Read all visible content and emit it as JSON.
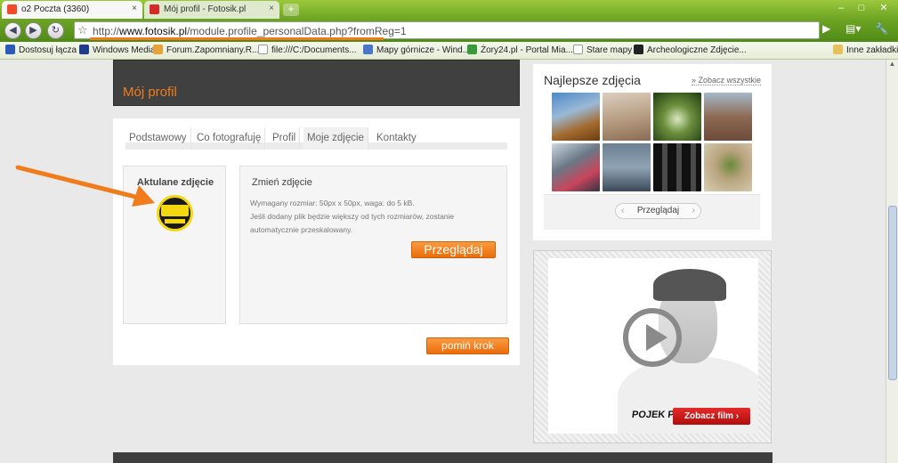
{
  "browser": {
    "tabs": [
      {
        "label": "o2 Poczta (3360)",
        "active": true
      },
      {
        "label": "Mój profil - Fotosik.pl",
        "active": false
      }
    ],
    "url_prefix": "http://",
    "url_domain": "www.fotosik.pl",
    "url_path": "/module.profile_personalData.php?fromReg=1",
    "bookmarks": [
      "Dostosuj łącza",
      "Windows Media",
      "Forum.Zapomniany.R...",
      "file:///C:/Documents...",
      "Mapy górnicze - Wind...",
      "Żory24.pl - Portal Mia...",
      "Stare mapy",
      "Archeologiczne Zdjęcie...",
      "Inne zakładki"
    ]
  },
  "page": {
    "profile_title": "Mój profil",
    "tabs": [
      "Podstawowy",
      "Co fotografuję",
      "Profil",
      "Moje zdjęcie",
      "Kontakty"
    ],
    "active_tab": "Moje zdjęcie",
    "current_photo_title": "Aktulane zdjęcie",
    "change_photo_title": "Zmień zdjęcie",
    "requirements_line1": "Wymagany rozmiar: 50px x 50px, waga: do 5 kB.",
    "requirements_line2": "Jeśli dodany plik będzie większy od tych rozmiarów, zostanie automatycznie przeskalowany.",
    "browse_button": "Przeglądaj",
    "skip_button": "pomiń krok"
  },
  "sidebar": {
    "best_photos_title": "Najlepsze zdjęcia",
    "see_all": "» Zobacz wszystkie",
    "gallery_button": "Przeglądaj"
  },
  "ad": {
    "logo_text": "POJEK P",
    "button": "Zobacz film ›"
  },
  "colors": {
    "accent_orange": "#f07c1c",
    "chrome_green": "#6fa524",
    "header_dark": "#404040",
    "ad_red": "#c41515"
  }
}
